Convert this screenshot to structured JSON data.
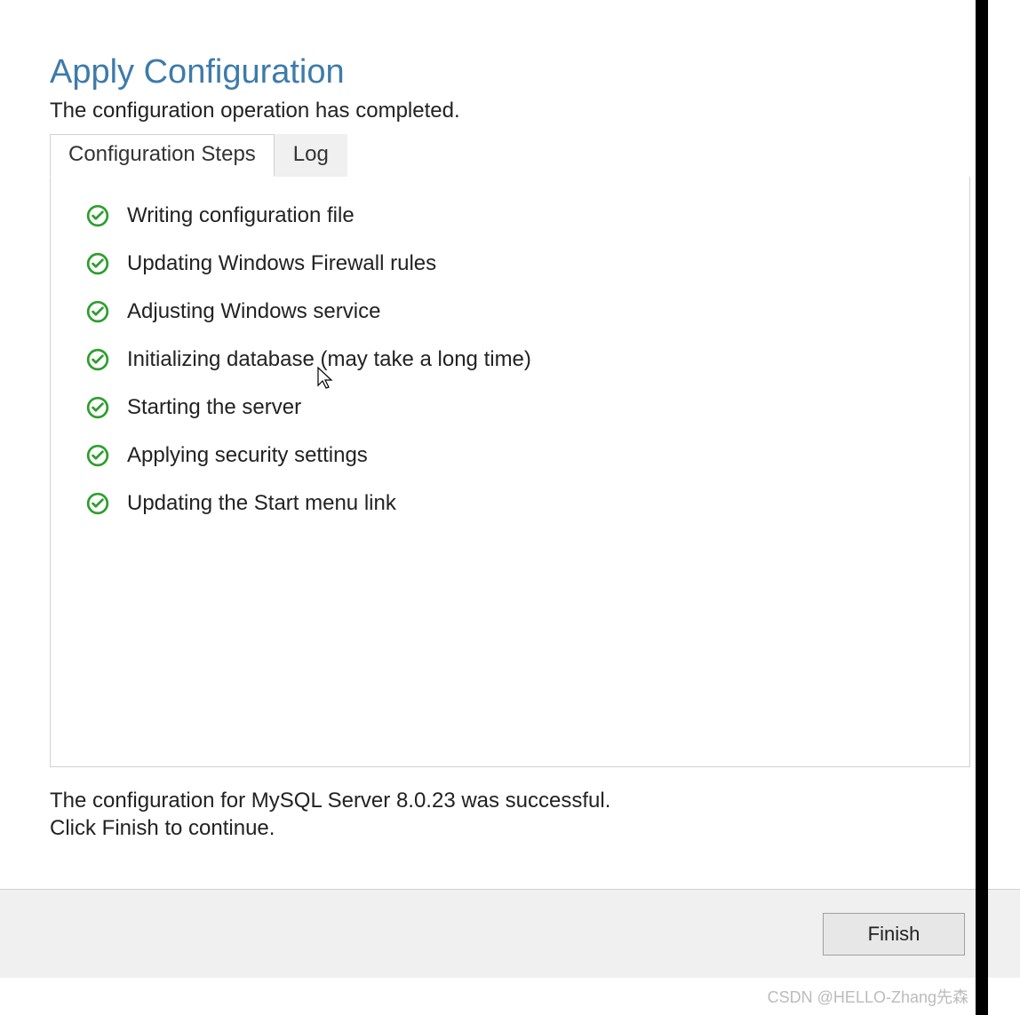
{
  "title": "Apply Configuration",
  "subtitle": "The configuration operation has completed.",
  "tabs": {
    "steps": "Configuration Steps",
    "log": "Log"
  },
  "steps": [
    {
      "label": "Writing configuration file"
    },
    {
      "label": "Updating Windows Firewall rules"
    },
    {
      "label": "Adjusting Windows service"
    },
    {
      "label": "Initializing database (may take a long time)"
    },
    {
      "label": "Starting the server"
    },
    {
      "label": "Applying security settings"
    },
    {
      "label": "Updating the Start menu link"
    }
  ],
  "status_line1": "The configuration for MySQL Server 8.0.23 was successful.",
  "status_line2": "Click Finish to continue.",
  "finish_button": "Finish",
  "watermark": "CSDN @HELLO-Zhang先森"
}
